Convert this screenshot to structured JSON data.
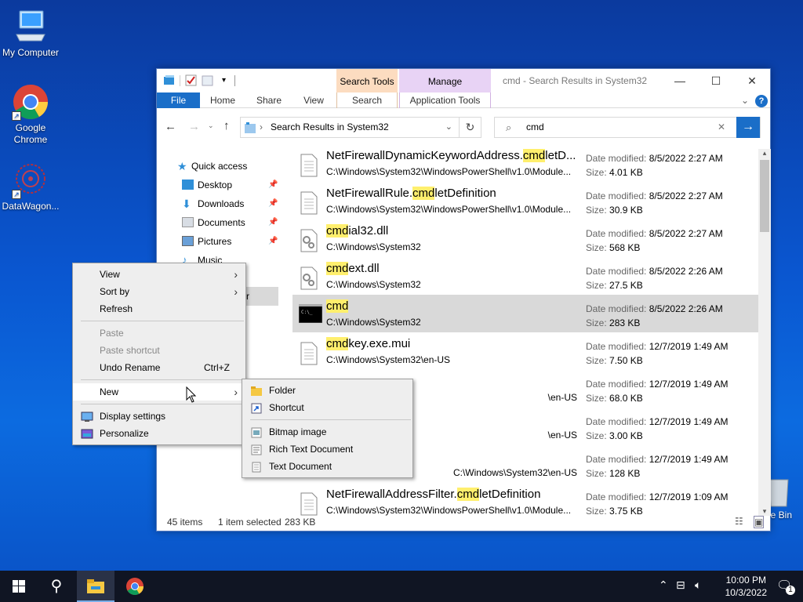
{
  "desktop": {
    "icons": [
      {
        "label": "My Computer"
      },
      {
        "label": "Google Chrome"
      },
      {
        "label": "DataWagon..."
      },
      {
        "label": "e Bin"
      }
    ]
  },
  "explorer": {
    "title": "cmd - Search Results in System32",
    "context_tabs": {
      "search_tools": "Search Tools",
      "manage": "Manage"
    },
    "ribbon_tabs": [
      "File",
      "Home",
      "Share",
      "View",
      "Search",
      "Application Tools"
    ],
    "address": "Search Results in System32",
    "search_value": "cmd",
    "nav": [
      {
        "label": "Quick access",
        "icon": "star-icon"
      },
      {
        "label": "Desktop",
        "icon": "desktop-folder-icon",
        "pinned": true
      },
      {
        "label": "Downloads",
        "icon": "download-folder-icon",
        "pinned": true
      },
      {
        "label": "Documents",
        "icon": "documents-folder-icon",
        "pinned": true
      },
      {
        "label": "Pictures",
        "icon": "pictures-folder-icon",
        "pinned": true
      },
      {
        "label": "Music",
        "icon": "music-folder-icon"
      },
      {
        "label": "r",
        "icon": ""
      }
    ],
    "results": [
      {
        "pre": "NetFirewallDynamicKeywordAddress.",
        "hl": "cmd",
        "post": "letD...",
        "path": "C:\\Windows\\System32\\WindowsPowerShell\\v1.0\\Module...",
        "date": "8/5/2022 2:27 AM",
        "size": "4.01 KB",
        "icon": "document-icon"
      },
      {
        "pre": "NetFirewallRule.",
        "hl": "cmd",
        "post": "letDefinition",
        "path": "C:\\Windows\\System32\\WindowsPowerShell\\v1.0\\Module...",
        "date": "8/5/2022 2:27 AM",
        "size": "30.9 KB",
        "icon": "document-icon"
      },
      {
        "pre": "",
        "hl": "cmd",
        "post": "ial32.dll",
        "path": "C:\\Windows\\System32",
        "date": "8/5/2022 2:27 AM",
        "size": "568 KB",
        "icon": "dll-gear-icon"
      },
      {
        "pre": "",
        "hl": "cmd",
        "post": "ext.dll",
        "path": "C:\\Windows\\System32",
        "date": "8/5/2022 2:26 AM",
        "size": "27.5 KB",
        "icon": "dll-gear-icon"
      },
      {
        "pre": "",
        "hl": "cmd",
        "post": "",
        "path": "C:\\Windows\\System32",
        "date": "8/5/2022 2:26 AM",
        "size": "283 KB",
        "icon": "console-icon",
        "selected": true
      },
      {
        "pre": "",
        "hl": "cmd",
        "post": "key.exe.mui",
        "path": "C:\\Windows\\System32\\en-US",
        "date": "12/7/2019 1:49 AM",
        "size": "7.50 KB",
        "icon": "document-icon"
      },
      {
        "pre": "",
        "hl": "",
        "post": "",
        "path": "\\en-US",
        "date": "12/7/2019 1:49 AM",
        "size": "68.0 KB",
        "icon": ""
      },
      {
        "pre": "",
        "hl": "",
        "post": "",
        "path": "\\en-US",
        "date": "12/7/2019 1:49 AM",
        "size": "3.00 KB",
        "icon": ""
      },
      {
        "pre": "",
        "hl": "",
        "post": "",
        "path": "C:\\Windows\\System32\\en-US",
        "date": "12/7/2019 1:49 AM",
        "size": "128 KB",
        "icon": ""
      },
      {
        "pre": "NetFirewallAddressFilter.",
        "hl": "cmd",
        "post": "letDefinition",
        "path": "C:\\Windows\\System32\\WindowsPowerShell\\v1.0\\Module...",
        "date": "12/7/2019 1:09 AM",
        "size": "3.75 KB",
        "icon": "document-icon"
      }
    ],
    "labels": {
      "date_modified": "Date modified:",
      "size": "Size:"
    },
    "status": {
      "items": "45 items",
      "selected": "1 item selected",
      "size": "283 KB"
    }
  },
  "context_menu": {
    "items": [
      {
        "label": "View",
        "submenu": true
      },
      {
        "label": "Sort by",
        "submenu": true
      },
      {
        "label": "Refresh"
      },
      {
        "sep": true
      },
      {
        "label": "Paste",
        "disabled": true
      },
      {
        "label": "Paste shortcut",
        "disabled": true
      },
      {
        "label": "Undo Rename",
        "key": "Ctrl+Z"
      },
      {
        "sep": true
      },
      {
        "label": "New",
        "submenu": true,
        "highlighted": true
      },
      {
        "sep": true
      },
      {
        "label": "Display settings",
        "icon": "display-icon"
      },
      {
        "label": "Personalize",
        "icon": "personalize-icon"
      }
    ]
  },
  "new_submenu": {
    "items": [
      {
        "label": "Folder",
        "icon": "folder-icon"
      },
      {
        "label": "Shortcut",
        "icon": "shortcut-icon"
      },
      {
        "sep": true
      },
      {
        "label": "Bitmap image",
        "icon": "bitmap-icon"
      },
      {
        "label": "Rich Text Document",
        "icon": "rtf-icon"
      },
      {
        "label": "Text Document",
        "icon": "text-doc-icon"
      }
    ]
  },
  "taskbar": {
    "time": "10:00 PM",
    "date": "10/3/2022",
    "notification_count": "1"
  },
  "colors": {
    "accent": "#1a6ec8",
    "highlight": "#ffef6d",
    "search_tools_tab": "#fcdcc0",
    "manage_tab": "#e8d3f5"
  }
}
